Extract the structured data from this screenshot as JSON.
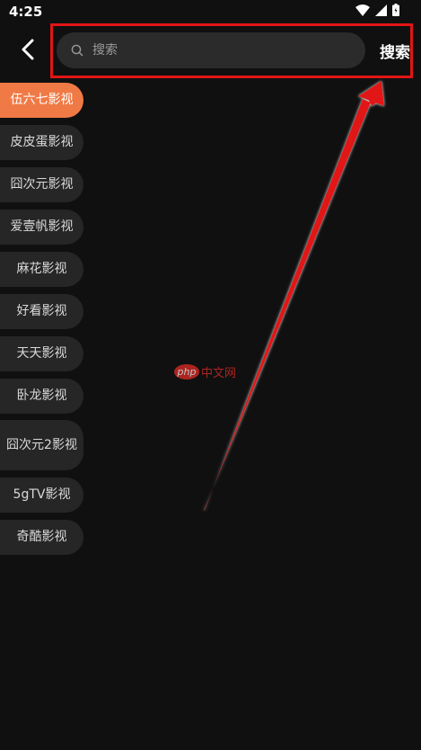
{
  "status_bar": {
    "time": "4:25",
    "icons": [
      "wifi-icon",
      "signal-icon",
      "battery-icon"
    ]
  },
  "header": {
    "back_icon": "chevron-left-icon",
    "search": {
      "placeholder": "搜索",
      "value": ""
    },
    "search_button_label": "搜索"
  },
  "sources": [
    {
      "label": "伍六七影视",
      "active": true
    },
    {
      "label": "皮皮蛋影视",
      "active": false
    },
    {
      "label": "囧次元影视",
      "active": false
    },
    {
      "label": "爱壹帆影视",
      "active": false
    },
    {
      "label": "麻花影视",
      "active": false
    },
    {
      "label": "好看影视",
      "active": false
    },
    {
      "label": "天天影视",
      "active": false
    },
    {
      "label": "卧龙影视",
      "active": false
    },
    {
      "label": "囧次元2影视",
      "active": false
    },
    {
      "label": "5gTV影视",
      "active": false
    },
    {
      "label": "奇酷影视",
      "active": false
    }
  ],
  "watermark": {
    "badge": "php",
    "text": "中文网"
  },
  "colors": {
    "background": "#101010",
    "accent": "#f07a46",
    "pill": "#262626",
    "annotation": "#e11515"
  }
}
